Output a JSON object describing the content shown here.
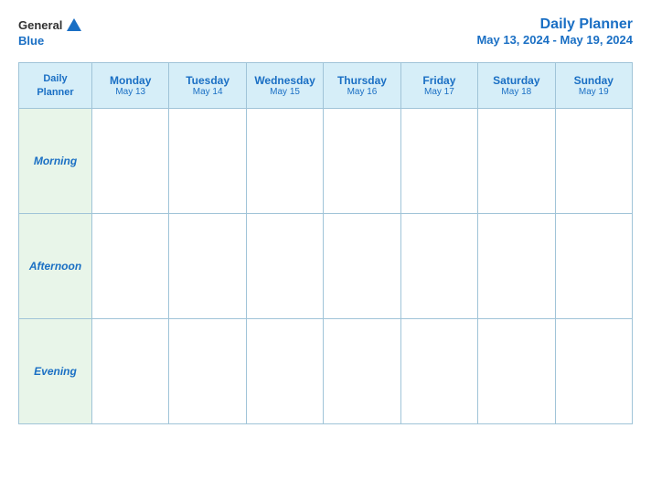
{
  "logo": {
    "general": "General",
    "blue": "Blue"
  },
  "title": {
    "main": "Daily Planner",
    "date_range": "May 13, 2024 - May 19, 2024"
  },
  "table": {
    "header": {
      "col0": {
        "line1": "Daily",
        "line2": "Planner"
      },
      "col1": {
        "day": "Monday",
        "date": "May 13"
      },
      "col2": {
        "day": "Tuesday",
        "date": "May 14"
      },
      "col3": {
        "day": "Wednesday",
        "date": "May 15"
      },
      "col4": {
        "day": "Thursday",
        "date": "May 16"
      },
      "col5": {
        "day": "Friday",
        "date": "May 17"
      },
      "col6": {
        "day": "Saturday",
        "date": "May 18"
      },
      "col7": {
        "day": "Sunday",
        "date": "May 19"
      }
    },
    "rows": [
      {
        "label": "Morning"
      },
      {
        "label": "Afternoon"
      },
      {
        "label": "Evening"
      }
    ]
  }
}
